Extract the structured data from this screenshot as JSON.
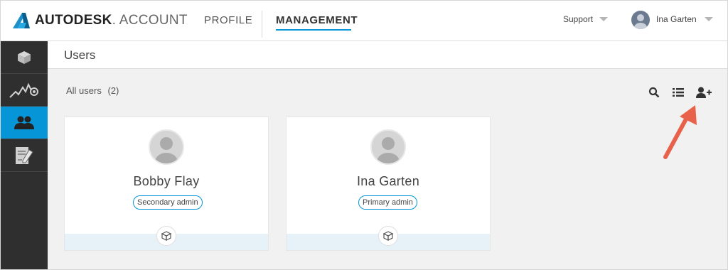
{
  "header": {
    "brand_bold": "AUTODESK",
    "brand_light": ". ACCOUNT",
    "nav": {
      "profile": "PROFILE",
      "management": "MANAGEMENT"
    },
    "support": "Support",
    "user_name": "Ina Garten"
  },
  "sidebar": {
    "items": [
      {
        "icon": "products-cube-icon"
      },
      {
        "icon": "usage-reports-icon"
      },
      {
        "icon": "users-icon",
        "active": true
      },
      {
        "icon": "billing-documents-icon"
      }
    ]
  },
  "page": {
    "title": "Users",
    "all_users_label": "All users",
    "all_users_count": "(2)",
    "toolbar": [
      "search-icon",
      "list-view-icon",
      "add-user-icon"
    ]
  },
  "users": [
    {
      "name": "Bobby Flay",
      "role": "Secondary admin"
    },
    {
      "name": "Ina Garten",
      "role": "Primary admin"
    }
  ],
  "colors": {
    "accent": "#0696d7",
    "sidebar": "#2f2f2f",
    "arrow": "#e8624b"
  }
}
